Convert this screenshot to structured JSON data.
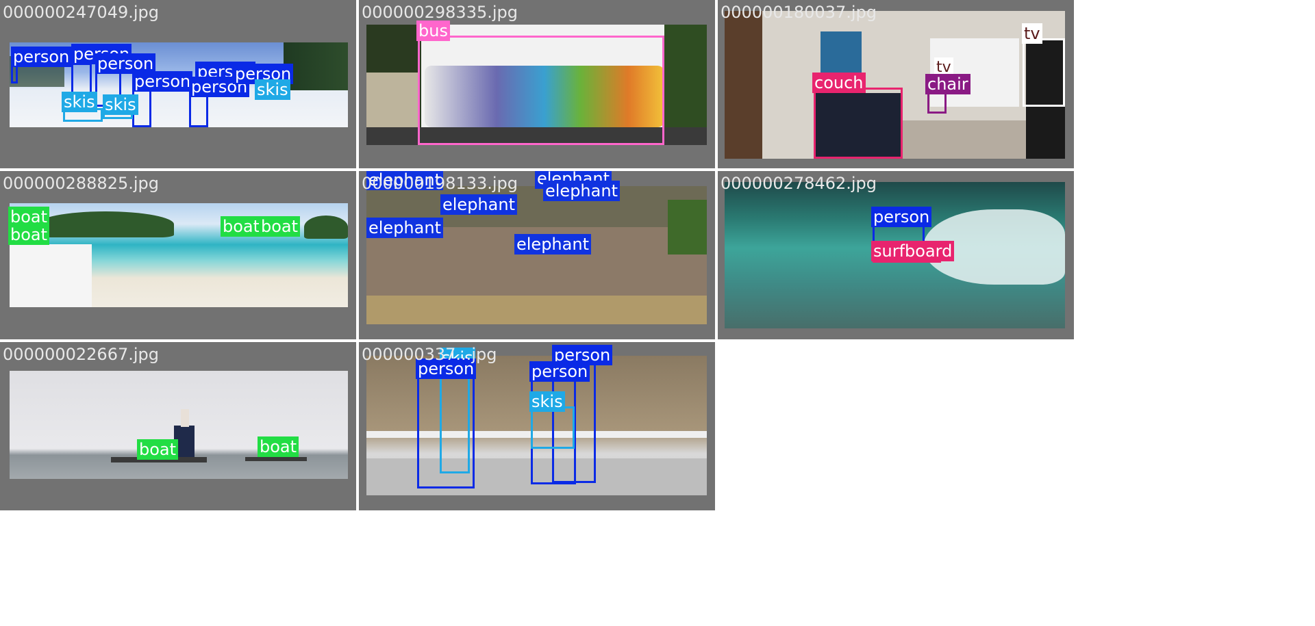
{
  "colors": {
    "person": "#0a2ae6",
    "skis": "#1fa9e6",
    "bus": "#ff66cc",
    "couch": "#e8246e",
    "chair": "#8a1a84",
    "tv": "#5a1a1a",
    "boat": "#22dd44",
    "elephant": "#1033e0",
    "surfboard": "#e8246e",
    "tile_bg": "#727272"
  },
  "tiles": [
    {
      "filename": "000000247049.jpg",
      "labels": [
        "person",
        "person",
        "person",
        "person",
        "person",
        "person",
        "person",
        "skis",
        "skis",
        "skis"
      ]
    },
    {
      "filename": "000000298335.jpg",
      "labels": [
        "bus"
      ]
    },
    {
      "filename": "000000180037.jpg",
      "labels": [
        "tv",
        "couch",
        "tv",
        "chair"
      ]
    },
    {
      "filename": "000000288825.jpg",
      "labels": [
        "boat",
        "boat",
        "boat",
        "boat"
      ]
    },
    {
      "filename": "000000198133.jpg",
      "labels": [
        "elephant",
        "elephant",
        "elephant",
        "elephant",
        "elephant",
        "elephant"
      ]
    },
    {
      "filename": "000000278462.jpg",
      "labels": [
        "person",
        "surfboard"
      ]
    },
    {
      "filename": "000000022667.jpg",
      "labels": [
        "boat",
        "boat"
      ]
    },
    {
      "filename": "000000337...jpg",
      "labels": [
        "skis",
        "person",
        "person",
        "person",
        "skis"
      ]
    }
  ]
}
